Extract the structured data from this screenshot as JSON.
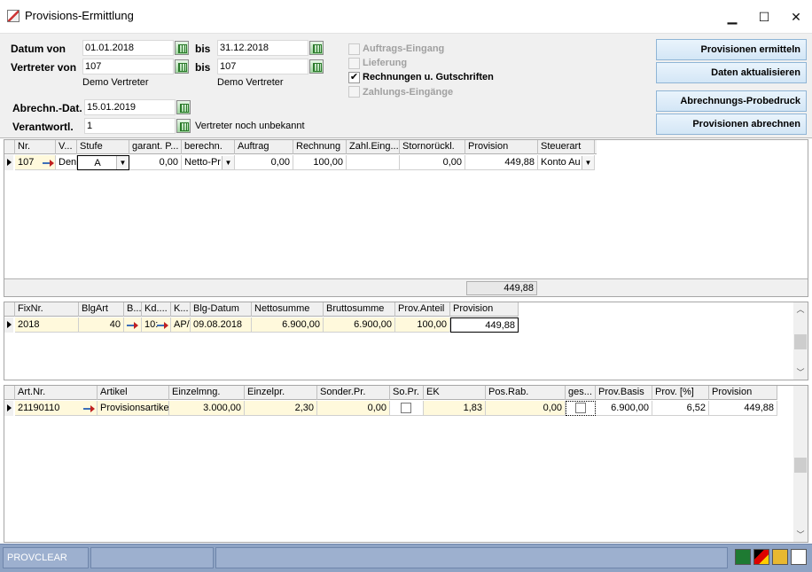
{
  "window": {
    "title": "Provisions-Ermittlung",
    "minimize": "▁",
    "maximize": "☐",
    "close": "✕"
  },
  "form": {
    "datum_von_label": "Datum von",
    "datum_von_value": "01.01.2018",
    "bis_label": "bis",
    "datum_bis_value": "31.12.2018",
    "vertreter_von_label": "Vertreter von",
    "vertreter_von_value": "107",
    "vertreter_bis_value": "107",
    "vertreter_von_name": "Demo Vertreter",
    "vertreter_bis_name": "Demo Vertreter",
    "abrechn_label": "Abrechn.-Dat.",
    "abrechn_value": "15.01.2019",
    "verantwortl_label": "Verantwortl.",
    "verantwortl_value": "1",
    "verantwortl_note": "Vertreter noch unbekannt"
  },
  "checks": [
    {
      "label": "Auftrags-Eingang",
      "checked": false,
      "disabled": true
    },
    {
      "label": "Lieferung",
      "checked": false,
      "disabled": true
    },
    {
      "label": "Rechnungen u. Gutschriften",
      "checked": true,
      "disabled": false
    },
    {
      "label": "Zahlungs-Eingänge",
      "checked": false,
      "disabled": true
    }
  ],
  "buttons": {
    "ermitteln": "Provisionen ermitteln",
    "aktualisieren": "Daten aktualisieren",
    "probedruck": "Abrechnungs-Probedruck",
    "abrechnen": "Provisionen abrechnen"
  },
  "grid1": {
    "headers": [
      "Nr.",
      "V...",
      "Stufe",
      "garant. P...",
      "berechn.",
      "Auftrag",
      "Rechnung",
      "Zahl.Eing...",
      "Stornorückl.",
      "Provision",
      "Steuerart"
    ],
    "row": {
      "nr": "107",
      "v": "Den",
      "stufe": "A",
      "garant": "0,00",
      "berechn": "Netto-Pr",
      "auftrag": "0,00",
      "rechnung": "100,00",
      "zahl": "",
      "storno": "0,00",
      "provision": "449,88",
      "steuerart": "Konto Au"
    },
    "sum": "449,88"
  },
  "grid2": {
    "headers": [
      "FixNr.",
      "BlgArt",
      "B...",
      "Kd....",
      "K...",
      "Blg-Datum",
      "Nettosumme",
      "Bruttosumme",
      "Prov.Anteil",
      "Provision"
    ],
    "row": {
      "fixnr": "2018",
      "blgart": "40",
      "kd": "10:",
      "k": "AP/",
      "datum": "09.08.2018",
      "netto": "6.900,00",
      "brutto": "6.900,00",
      "anteil": "100,00",
      "provision": "449,88"
    }
  },
  "grid3": {
    "headers": [
      "Art.Nr.",
      "Artikel",
      "Einzelmng.",
      "Einzelpr.",
      "Sonder.Pr.",
      "So.Pr.",
      "EK",
      "Pos.Rab.",
      "ges...",
      "Prov.Basis",
      "Prov. [%]",
      "Provision"
    ],
    "row": {
      "artnr": "21190110",
      "artikel": "Provisionsartikel",
      "menge": "3.000,00",
      "preis": "2,30",
      "sonder": "0,00",
      "ek": "1,83",
      "rab": "0,00",
      "basis": "6.900,00",
      "prozent": "6,52",
      "provision": "449,88"
    }
  },
  "status": {
    "code": "PROVCLEAR"
  },
  "colors": {
    "button_border": "#8fb5d6",
    "status_bg": "#8ea3c4",
    "row_highlight": "#fff9dc"
  }
}
